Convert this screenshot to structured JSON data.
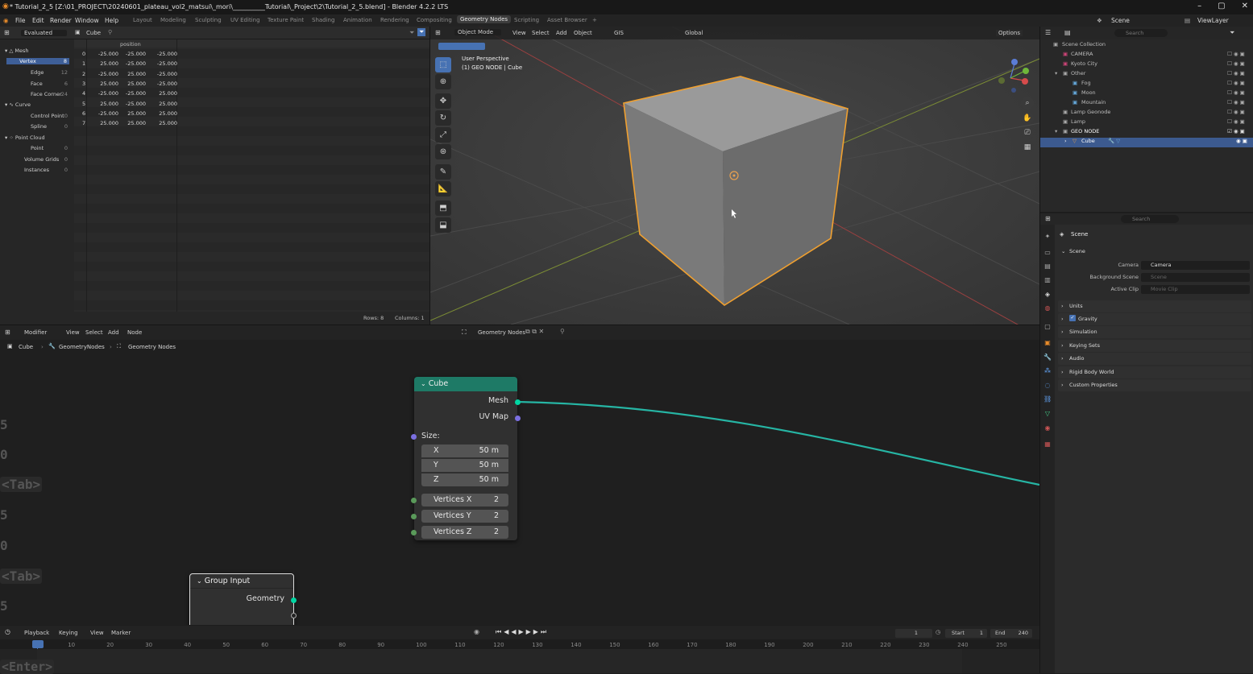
{
  "titlebar": {
    "title": "* Tutorial_2_5 [Z:\\01_PROJECT\\20240601_plateau_vol2_matsui\\_mori\\__________Tutorial\\_Project\\2\\Tutorial_2_5.blend] - Blender 4.2.2 LTS",
    "minimize": "–",
    "maximize": "▢",
    "close": "✕"
  },
  "menu": {
    "items": [
      "File",
      "Edit",
      "Render",
      "Window",
      "Help"
    ],
    "workspaces": [
      "Layout",
      "Modeling",
      "Sculpting",
      "UV Editing",
      "Texture Paint",
      "Shading",
      "Animation",
      "Rendering",
      "Compositing",
      "Geometry Nodes",
      "Scripting",
      "Asset Browser"
    ],
    "active_workspace": "Geometry Nodes",
    "add_ws": "+",
    "scene": "Scene",
    "viewlayer": "ViewLayer"
  },
  "spreadsheet": {
    "mode": "Evaluated",
    "object": "Cube",
    "column_header": "position",
    "tree": [
      {
        "label": "Mesh",
        "count": ""
      },
      {
        "label": "Vertex",
        "count": "8"
      },
      {
        "label": "Edge",
        "count": "12"
      },
      {
        "label": "Face",
        "count": "6"
      },
      {
        "label": "Face Corner",
        "count": "24"
      },
      {
        "label": "Curve",
        "count": ""
      },
      {
        "label": "Control Point",
        "count": "0"
      },
      {
        "label": "Spline",
        "count": "0"
      },
      {
        "label": "Point Cloud",
        "count": ""
      },
      {
        "label": "Point",
        "count": "0"
      },
      {
        "label": "Volume Grids",
        "count": "0"
      },
      {
        "label": "Instances",
        "count": "0"
      }
    ],
    "rows": [
      [
        "0",
        "-25.000",
        "-25.000",
        "-25.000"
      ],
      [
        "1",
        "25.000",
        "-25.000",
        "-25.000"
      ],
      [
        "2",
        "-25.000",
        "25.000",
        "-25.000"
      ],
      [
        "3",
        "25.000",
        "25.000",
        "-25.000"
      ],
      [
        "4",
        "-25.000",
        "-25.000",
        "25.000"
      ],
      [
        "5",
        "25.000",
        "-25.000",
        "25.000"
      ],
      [
        "6",
        "-25.000",
        "25.000",
        "25.000"
      ],
      [
        "7",
        "25.000",
        "25.000",
        "25.000"
      ]
    ],
    "footer_rows": "Rows: 8",
    "footer_cols": "Columns: 1"
  },
  "viewport": {
    "mode": "Object Mode",
    "menus": [
      "View",
      "Select",
      "Add",
      "Object"
    ],
    "gis": "GIS",
    "orientation": "Global",
    "options": "Options",
    "overlay_title": "User Perspective",
    "overlay_sub": "(1) GEO NODE | Cube",
    "tools": [
      "select-box",
      "cursor",
      "move",
      "rotate",
      "scale",
      "transform",
      "annotate",
      "measure",
      "add-cube",
      "extrude"
    ]
  },
  "outliner": {
    "search": "Search",
    "rows": [
      {
        "label": "Scene Collection",
        "sel": false
      },
      {
        "label": "CAMERA",
        "sel": false
      },
      {
        "label": "Kyoto City",
        "sel": false
      },
      {
        "label": "Other",
        "sel": false
      },
      {
        "label": "Fog",
        "sel": false
      },
      {
        "label": "Moon",
        "sel": false
      },
      {
        "label": "Mountain",
        "sel": false
      },
      {
        "label": "Lamp Geonode",
        "sel": false
      },
      {
        "label": "Lamp",
        "sel": false
      },
      {
        "label": "GEO NODE",
        "sel": false
      },
      {
        "label": "Cube",
        "sel": true
      }
    ]
  },
  "properties": {
    "search": "Search",
    "scene_name": "Scene",
    "section_scene": "Scene",
    "camera_label": "Camera",
    "camera_value": "Camera",
    "bg_label": "Background Scene",
    "bg_value": "Scene",
    "clip_label": "Active Clip",
    "clip_value": "Movie Clip",
    "sections": [
      "Units",
      "Gravity",
      "Simulation",
      "Keying Sets",
      "Audio",
      "Rigid Body World",
      "Custom Properties"
    ]
  },
  "node_editor": {
    "editor_type": "Modifier",
    "menus": [
      "View",
      "Select",
      "Add",
      "Node"
    ],
    "tree_name": "Geometry Nodes",
    "breadcrumb": [
      "Cube",
      "GeometryNodes",
      "Geometry Nodes"
    ],
    "cube_node": {
      "title": "Cube",
      "out_mesh": "Mesh",
      "out_uv": "UV Map",
      "size_label": "Size:",
      "fields": [
        {
          "label": "X",
          "value": "50 m"
        },
        {
          "label": "Y",
          "value": "50 m"
        },
        {
          "label": "Z",
          "value": "50 m"
        },
        {
          "label": "Vertices X",
          "value": "2"
        },
        {
          "label": "Vertices Y",
          "value": "2"
        },
        {
          "label": "Vertices Z",
          "value": "2"
        }
      ]
    },
    "group_input": {
      "title": "Group Input",
      "out": "Geometry"
    },
    "keycaps": [
      "5",
      "0",
      "<Tab>",
      "5",
      "0",
      "<Tab>",
      "5",
      "<Enter>"
    ]
  },
  "timeline": {
    "menus": [
      "Playback",
      "Keying",
      "View",
      "Marker"
    ],
    "current_frame": "1",
    "start_label": "Start",
    "start": "1",
    "end_label": "End",
    "end": "240",
    "ticks": [
      "1",
      "10",
      "20",
      "30",
      "40",
      "50",
      "60",
      "70",
      "80",
      "90",
      "100",
      "110",
      "120",
      "130",
      "140",
      "150",
      "160",
      "170",
      "180",
      "190",
      "200",
      "210",
      "220",
      "230",
      "240",
      "250"
    ]
  },
  "colors": {
    "accent": "#4772b3",
    "selection_orange": "#f0a030",
    "node_header_green": "#1e7a66",
    "link": "#26b5a4"
  }
}
